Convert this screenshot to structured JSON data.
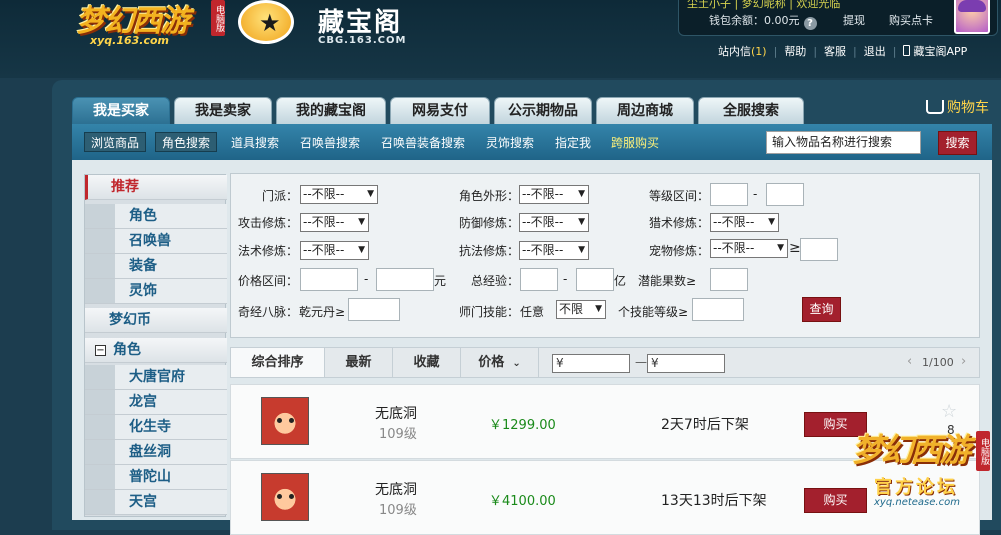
{
  "header": {
    "game_logo": "梦幻西游",
    "game_logo_tag": "电脑版",
    "game_logo_url": "xyq.163.com",
    "cbg_name": "藏宝阁",
    "cbg_url": "CBG.163.COM",
    "user_line": "尘土小子 | 梦幻昵称 | 欢迎光临",
    "balance_label": "钱包余额：0.00元",
    "withdraw": "提现",
    "buy_card": "购买点卡",
    "links": {
      "inbox": "站内信",
      "inbox_count": "(1)",
      "help": "帮助",
      "service": "客服",
      "logout": "退出",
      "app": "藏宝阁APP"
    }
  },
  "tabs": [
    "我是买家",
    "我是卖家",
    "我的藏宝阁",
    "网易支付",
    "公示期物品",
    "周边商城",
    "全服搜索"
  ],
  "cart": "购物车",
  "subnav": [
    "浏览商品",
    "角色搜索",
    "道具搜索",
    "召唤兽搜索",
    "召唤兽装备搜索",
    "灵饰搜索",
    "指定我",
    "跨服购买"
  ],
  "search": {
    "value": "输入物品名称进行搜索",
    "button": "搜索"
  },
  "sidebar": {
    "recommend": "推荐",
    "items1": [
      "角色",
      "召唤兽",
      "装备",
      "灵饰"
    ],
    "currency": "梦幻币",
    "role_group": "角色",
    "role_toggle": "−",
    "items2": [
      "大唐官府",
      "龙宫",
      "化生寺",
      "盘丝洞",
      "普陀山",
      "天宫"
    ]
  },
  "filter": {
    "school": "门派：",
    "school_val": "--不限--",
    "appearance": "角色外形：",
    "appearance_val": "--不限--",
    "level_range": "等级区间：",
    "dash": "-",
    "attack": "攻击修炼：",
    "attack_val": "--不限--",
    "defense": "防御修炼：",
    "defense_val": "--不限--",
    "hunt": "猎术修炼：",
    "hunt_val": "--不限--",
    "magic": "法术修炼：",
    "magic_val": "--不限--",
    "resist": "抗法修炼：",
    "resist_val": "--不限--",
    "pet": "宠物修炼：",
    "pet_val": "--不限--",
    "gte": "≥",
    "price": "价格区间：",
    "yuan": "元",
    "exp": "总经验：",
    "yi": "亿",
    "potential": "潜能果数≥",
    "meridian": "奇经八脉：",
    "meridian_val": "乾元丹≥",
    "skill": "师门技能：",
    "skill_any": "任意",
    "skill_val": "不限",
    "skill_level": "个技能等级≥",
    "query": "查询"
  },
  "sortbar": {
    "sorts": [
      "综合排序",
      "最新",
      "收藏",
      "价格"
    ],
    "price_prefix": "¥",
    "dash": "—",
    "page": "1/100",
    "prev": "‹",
    "next": "›"
  },
  "results": [
    {
      "name": "无底洞",
      "level": "109级",
      "price": "￥1299.00",
      "time": "2天7时后下架",
      "buy": "购买",
      "fav": "8"
    },
    {
      "name": "无底洞",
      "level": "109级",
      "price": "￥4100.00",
      "time": "13天13时后下架",
      "buy": "购买",
      "fav": ""
    }
  ],
  "watermark": {
    "logo": "梦幻西游",
    "tag": "电脑版",
    "forum": "官方论坛",
    "url": "xyq.netease.com"
  }
}
